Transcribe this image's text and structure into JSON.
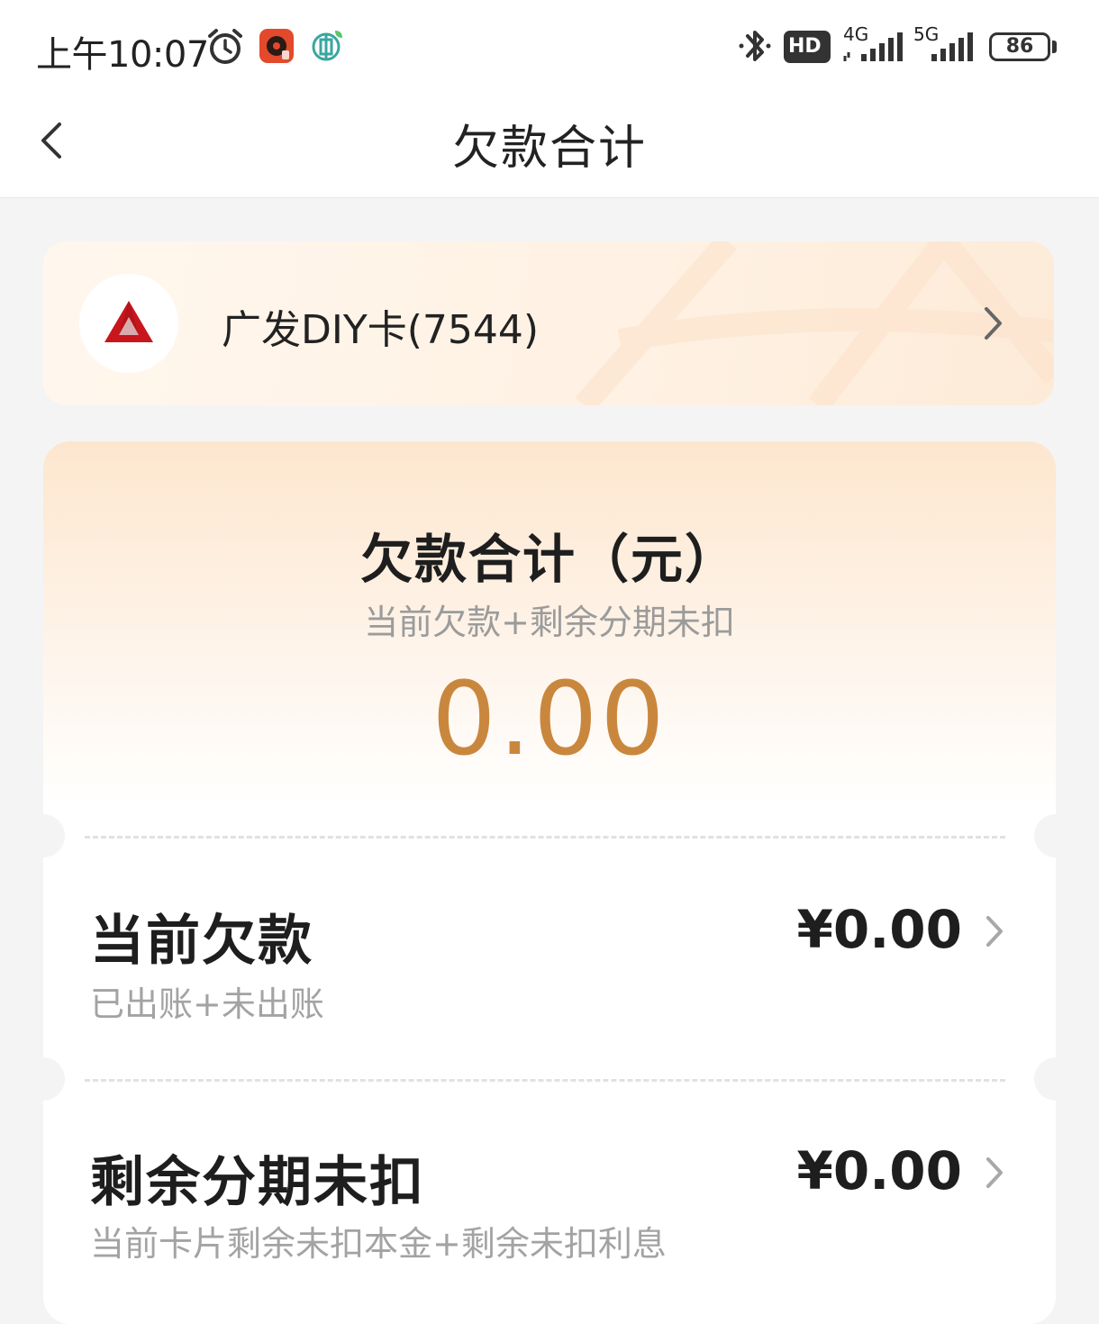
{
  "status_bar": {
    "time": "上午10:07",
    "hd_label": "HD",
    "net_4g": "4G",
    "net_5g": "5G",
    "battery": "86"
  },
  "header": {
    "title": "欠款合计"
  },
  "card_selector": {
    "card_name": "广发DIY卡(7544)",
    "logo_color": "#c8161d"
  },
  "summary": {
    "title": "欠款合计（元）",
    "subtitle": "当前欠款+剩余分期未扣",
    "amount": "0.00",
    "amount_color": "#c9873e"
  },
  "rows": [
    {
      "title": "当前欠款",
      "desc": "已出账+未出账",
      "amount": "¥0.00"
    },
    {
      "title": "剩余分期未扣",
      "desc": "当前卡片剩余未扣本金+剩余未扣利息",
      "amount": "¥0.00"
    }
  ]
}
